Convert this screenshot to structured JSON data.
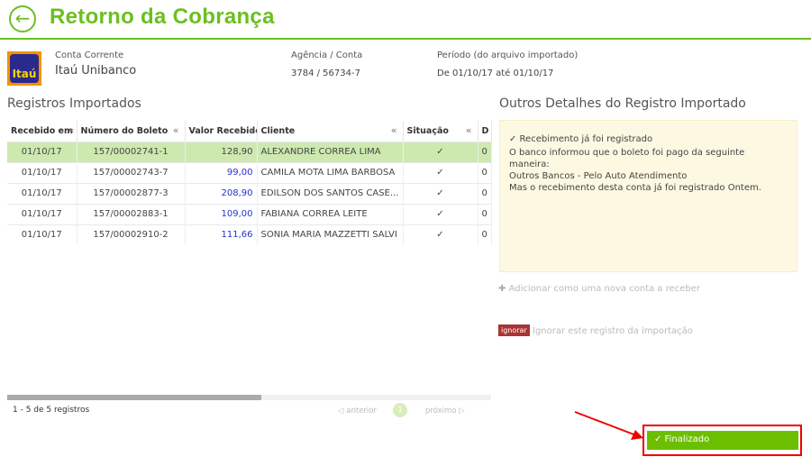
{
  "header": {
    "title": "Retorno da Cobrança",
    "back_icon": "arrow-left-circle-icon"
  },
  "account": {
    "logo_text": "Itaú",
    "type_label": "Conta Corrente",
    "bank": "Itaú Unibanco",
    "agency_label": "Agência / Conta",
    "agency_value": "3784 / 56734-7",
    "period_label": "Período (do arquivo importado)",
    "period_value": "De 01/10/17 até 01/10/17"
  },
  "registros": {
    "title": "Registros Importados",
    "columns": [
      "Recebido em",
      "Número do Boleto",
      "Valor Recebido",
      "Cliente",
      "Situação",
      "D"
    ],
    "rows": [
      {
        "date": "01/10/17",
        "boleto": "157/00002741-1",
        "valor": "128,90",
        "cliente": "ALEXANDRE CORREA LIMA",
        "situacao": "✓",
        "d": "0",
        "selected": true
      },
      {
        "date": "01/10/17",
        "boleto": "157/00002743-7",
        "valor": "99,00",
        "cliente": "CAMILA MOTA LIMA BARBOSA",
        "situacao": "✓",
        "d": "0"
      },
      {
        "date": "01/10/17",
        "boleto": "157/00002877-3",
        "valor": "208,90",
        "cliente": "EDILSON DOS SANTOS CASE...",
        "situacao": "✓",
        "d": "0"
      },
      {
        "date": "01/10/17",
        "boleto": "157/00002883-1",
        "valor": "109,00",
        "cliente": "FABIANA CORREA LEITE",
        "situacao": "✓",
        "d": "0"
      },
      {
        "date": "01/10/17",
        "boleto": "157/00002910-2",
        "valor": "111,66",
        "cliente": "SONIA MARIA MAZZETTI SALVI",
        "situacao": "✓",
        "d": "0"
      }
    ],
    "count": "1 - 5 de 5 registros",
    "prev": "anterior",
    "page": "1",
    "next": "próximo"
  },
  "details": {
    "title": "Outros Detalhes do Registro Importado",
    "line1": "✓ Recebimento já foi registrado",
    "line2": "O banco informou que o boleto foi pago da seguinte maneira:",
    "line3": "Outros Bancos - Pelo Auto Atendimento",
    "line4": "Mas o recebimento desta conta já foi registrado Ontem.",
    "add": "Adicionar como uma nova conta a receber",
    "ignore_badge": "ignorar",
    "ignore_text": "Ignorar este registro da importação"
  },
  "finish": {
    "label": "✓ Finalizado"
  },
  "colors": {
    "accent": "#6cbf1f",
    "highlight": "#e00000"
  }
}
